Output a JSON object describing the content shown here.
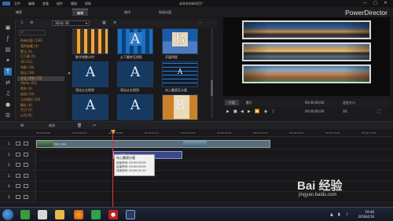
{
  "window": {
    "menu": [
      "文件",
      "编辑",
      "查看",
      "插件",
      "播放",
      "帮助"
    ],
    "doc_title": "未命名的新项目*",
    "controls": [
      "—",
      "□",
      "✕"
    ]
  },
  "mode_tabs": [
    {
      "label": "捕获",
      "active": false
    },
    {
      "label": "编辑",
      "active": true
    },
    {
      "label": "制作",
      "active": false
    },
    {
      "label": "刻录光盘",
      "active": false
    }
  ],
  "brand": "PowerDirector",
  "library": {
    "filter_value": "3D/非 3D",
    "search_icon": "search-icon",
    "categories": [
      {
        "label": "所有内容 (136)",
        "selected": false
      },
      {
        "label": "我的收藏 (0)",
        "selected": false
      },
      {
        "label": "默认 (0)",
        "selected": false
      },
      {
        "label": "已下载 (0)",
        "selected": false
      },
      {
        "label": "3D (12)",
        "selected": false
      },
      {
        "label": "电影 (18)",
        "selected": false
      },
      {
        "label": "简洁 (16)",
        "selected": false
      },
      {
        "label": "文化_传统 (15)",
        "selected": true
      },
      {
        "label": "Alpha (15)",
        "selected": false
      },
      {
        "label": "商务 (9)",
        "selected": false
      },
      {
        "label": "旅游 (10)",
        "selected": false
      },
      {
        "label": "几何图形 (26)",
        "selected": false
      },
      {
        "label": "婚礼 (6)",
        "selected": false
      },
      {
        "label": "生日 (3)",
        "selected": false
      },
      {
        "label": "公司 (6)",
        "selected": false
      }
    ],
    "templates": [
      {
        "label": "数字倒数计时",
        "glyph": "",
        "style": "bars"
      },
      {
        "label": "从下翻转至视框",
        "glyph": "A",
        "style": "check"
      },
      {
        "label": "开展明星",
        "glyph": "B",
        "style": "b"
      },
      {
        "label": "滑动从左侧到",
        "glyph": "A",
        "style": "dark"
      },
      {
        "label": "滑动从右侧到",
        "glyph": "A",
        "style": "dark"
      },
      {
        "label": "向上翻滚至计量",
        "glyph": "A",
        "style": "lines"
      },
      {
        "label": "",
        "glyph": "A",
        "style": "dark"
      },
      {
        "label": "",
        "glyph": "A",
        "style": "dark"
      },
      {
        "label": "",
        "glyph": "B",
        "style": "orange2"
      }
    ]
  },
  "preview": {
    "tabs": [
      {
        "label": "片段",
        "active": true
      },
      {
        "label": "影片",
        "active": false
      }
    ],
    "timecode_current": "00;00;00;00",
    "timecode_total": "00;00;00;00",
    "fit_label": "适合大小",
    "mode_label": "3D"
  },
  "timeline": {
    "toolbar_label": "修改",
    "ruler_labels": [
      "00;00;00;00",
      "00;00;04;04",
      "00;00;08;08",
      "00;00;12;12",
      "00;00;16;16",
      "00;00;20;20",
      "00;00;24;24",
      "00;00;29;00",
      "00;00;33;04",
      "00;00;37;06"
    ],
    "tracks": [
      "1.",
      "1.",
      "2.",
      "2.",
      "3.",
      "3."
    ],
    "video_clip_name": "Clip_1.jpg",
    "title_clip_name": "向上翻滚计量",
    "tooltip": {
      "title": "向上翻滚计量",
      "rows": [
        "起始时间: 00:00:03:03",
        "结束时间: 00:00:05:00",
        "持续时间: 00:00:02:10"
      ]
    }
  },
  "watermark": {
    "text": "Bai 经验",
    "sub": "jingyan.baidu.com"
  },
  "taskbar": {
    "time": "19:46",
    "date": "2018/4/16"
  },
  "colors": {
    "accent": "#2f74b8",
    "category_text": "#d28a2a",
    "playhead": "#e03535"
  }
}
